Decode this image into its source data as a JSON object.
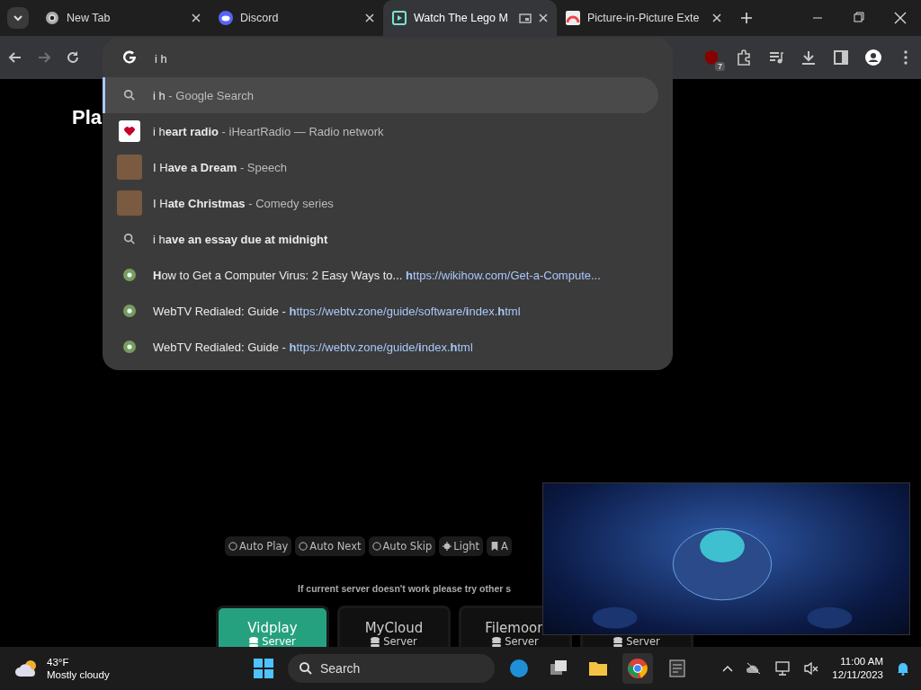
{
  "tabs": [
    {
      "title": "New Tab",
      "selected": false
    },
    {
      "title": "Discord",
      "selected": false
    },
    {
      "title": "Watch The Lego M",
      "selected": true
    },
    {
      "title": "Picture-in-Picture Exte",
      "selected": false
    }
  ],
  "omnibox": {
    "value": "i h"
  },
  "suggestions": [
    {
      "kind": "search",
      "text": "i h",
      "description": "- Google Search",
      "selected": true
    },
    {
      "kind": "logo",
      "text": "i h**eart radio**",
      "description": "- iHeartRadio — Radio network",
      "selected": false
    },
    {
      "kind": "photo",
      "text": "I H**ave a Dream**",
      "description": "- Speech",
      "selected": false
    },
    {
      "kind": "photo",
      "text": "I H**ate Christmas**",
      "description": "- Comedy series",
      "selected": false
    },
    {
      "kind": "search",
      "text": "i h**ave an essay due at midnight**",
      "selected": false
    },
    {
      "kind": "site",
      "text": "**H**ow to Get a Computer Virus: 2 Easy Ways to...",
      "url": "**h**ttps://wikihow.com/Get-a-Compute...",
      "selected": false
    },
    {
      "kind": "site",
      "text": "WebTV Redialed: Guide -",
      "url": "**h**ttps://webtv.zone/guide/software/**i**ndex.**h**tml",
      "selected": false
    },
    {
      "kind": "site",
      "text": "WebTV Redialed: Guide -",
      "url": "**h**ttps://webtv.zone/guide/**i**ndex.**h**tml",
      "selected": false
    }
  ],
  "toolbar": {
    "extension_badge": "7"
  },
  "page": {
    "title": "Pla",
    "toggles": [
      {
        "label": "Auto Play",
        "kind": "toggle"
      },
      {
        "label": "Auto Next",
        "kind": "toggle"
      },
      {
        "label": "Auto Skip",
        "kind": "toggle"
      },
      {
        "label": "Light",
        "kind": "theme"
      },
      {
        "label": "A",
        "kind": "bookmark"
      }
    ],
    "notice": "If current server doesn't work please try other s",
    "servers": [
      {
        "name": "Vidplay",
        "sub": "Server",
        "selected": true
      },
      {
        "name": "MyCloud",
        "sub": "Server",
        "selected": false
      },
      {
        "name": "Filemoon",
        "sub": "Server",
        "selected": false
      },
      {
        "sub": "Server",
        "selected": false
      }
    ]
  },
  "taskbar": {
    "temperature": "43°F",
    "weather": "Mostly cloudy",
    "search": "Search",
    "time": "11:00 AM",
    "date": "12/11/2023"
  }
}
